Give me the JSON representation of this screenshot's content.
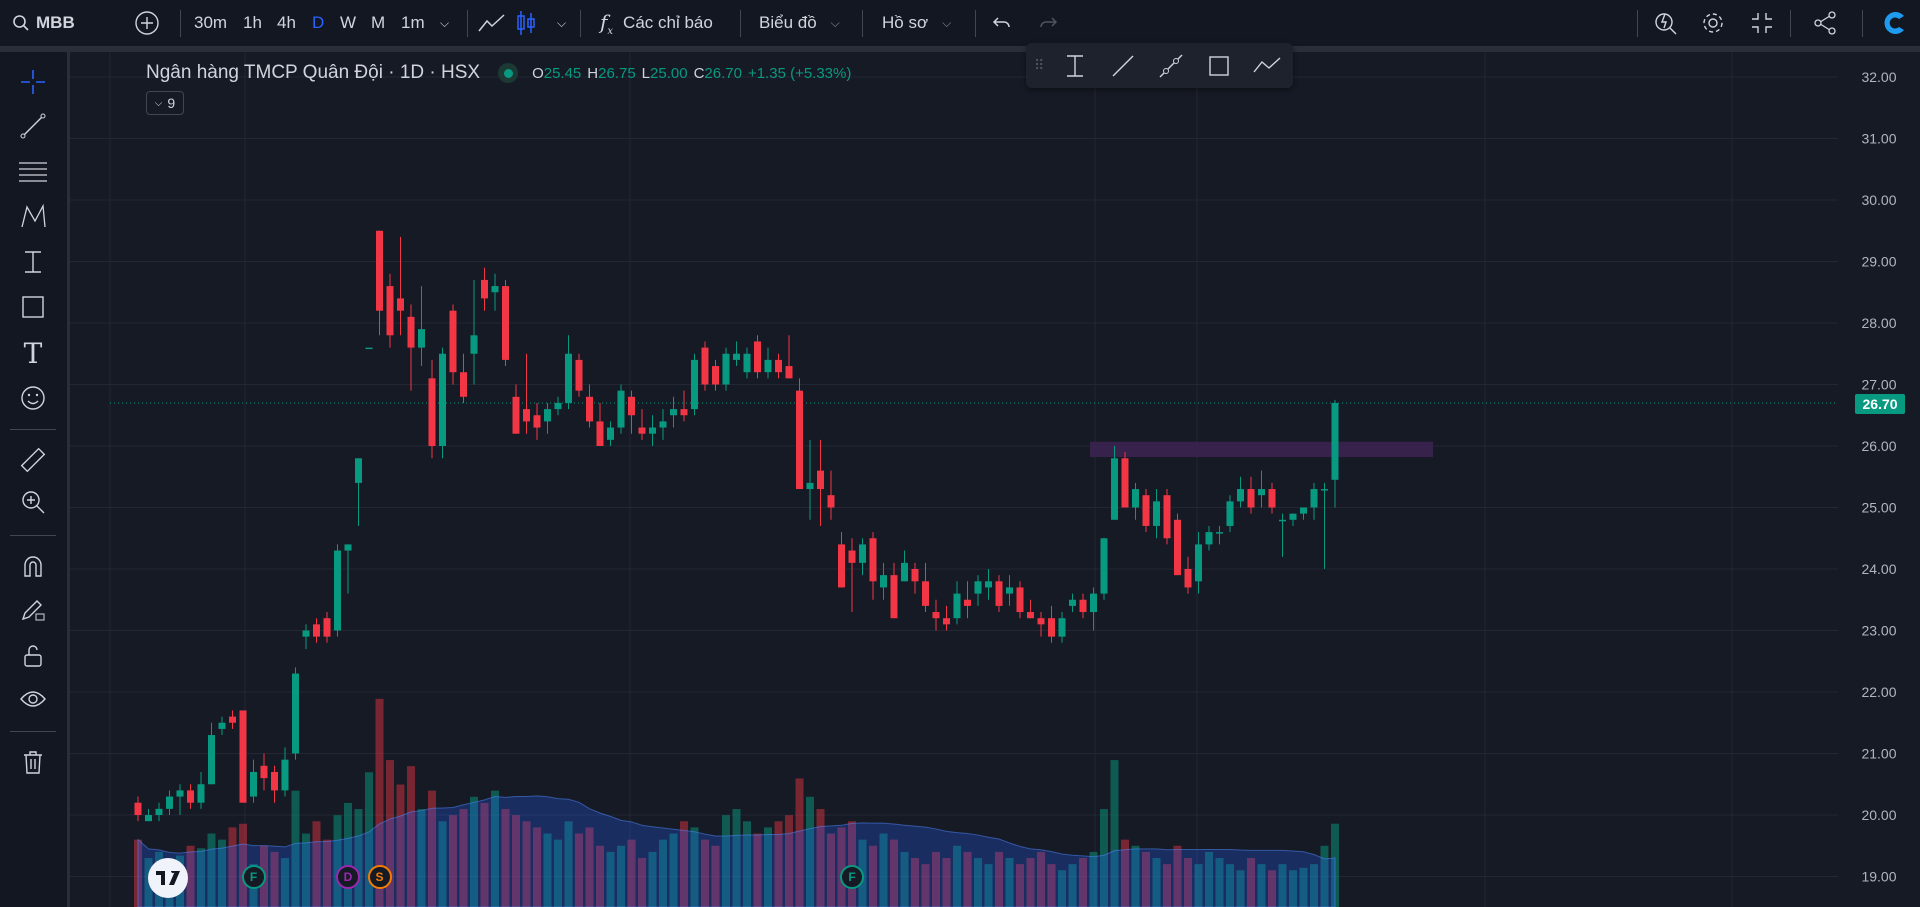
{
  "symbol": "MBB",
  "toolbar": {
    "intervals": [
      "30m",
      "1h",
      "4h",
      "D",
      "W",
      "M",
      "1m"
    ],
    "active_interval": "D",
    "indicators_label": "Các chỉ báo",
    "chart_label": "Biểu đồ",
    "profile_label": "Hồ sơ"
  },
  "legend": {
    "title": "Ngân hàng TMCP Quân Đội · 1D · HSX",
    "o_label": "O",
    "open": "25.45",
    "h_label": "H",
    "high": "26.75",
    "l_label": "L",
    "low": "25.00",
    "c_label": "C",
    "close": "26.70",
    "change": "+1.35 (+5.33%)",
    "collapsed_count": "9"
  },
  "last_price": "26.70",
  "colors": {
    "up": "#089981",
    "down": "#f23645",
    "accent": "#2962ff",
    "zone": "#3a2350"
  },
  "price_axis": [
    "32.00",
    "31.00",
    "30.00",
    "29.00",
    "28.00",
    "27.00",
    "26.00",
    "25.00",
    "24.00",
    "23.00",
    "22.00",
    "21.00",
    "20.00",
    "19.00"
  ],
  "chart_data": {
    "type": "candlestick",
    "ylim": [
      19,
      32
    ],
    "last": 26.7,
    "zone": [
      25.82,
      26.07
    ],
    "candles": [
      [
        20.2,
        20.3,
        19.9,
        20.0
      ],
      [
        19.9,
        20.1,
        19.9,
        20.0
      ],
      [
        20.0,
        20.2,
        19.9,
        20.1
      ],
      [
        20.1,
        20.4,
        20.0,
        20.3
      ],
      [
        20.3,
        20.5,
        20.0,
        20.4
      ],
      [
        20.4,
        20.5,
        20.1,
        20.2
      ],
      [
        20.2,
        20.7,
        20.1,
        20.5
      ],
      [
        20.5,
        21.5,
        20.5,
        21.3
      ],
      [
        21.4,
        21.6,
        21.3,
        21.5
      ],
      [
        21.6,
        21.7,
        21.4,
        21.5
      ],
      [
        21.7,
        21.7,
        20.2,
        20.2
      ],
      [
        20.3,
        20.9,
        20.2,
        20.7
      ],
      [
        20.8,
        21.0,
        20.4,
        20.6
      ],
      [
        20.7,
        20.8,
        20.2,
        20.4
      ],
      [
        20.4,
        21.1,
        20.3,
        20.9
      ],
      [
        21.0,
        22.4,
        20.9,
        22.3
      ],
      [
        22.9,
        23.1,
        22.7,
        23.0
      ],
      [
        23.1,
        23.2,
        22.8,
        22.9
      ],
      [
        23.2,
        23.3,
        22.8,
        22.9
      ],
      [
        23.0,
        24.4,
        22.9,
        24.3
      ],
      [
        24.3,
        24.4,
        23.6,
        24.4
      ],
      [
        25.4,
        25.8,
        24.7,
        25.8
      ],
      [
        27.6,
        27.6,
        27.6,
        27.6
      ],
      [
        29.5,
        29.5,
        27.8,
        28.2
      ],
      [
        28.6,
        28.8,
        27.6,
        27.8
      ],
      [
        28.4,
        29.4,
        27.8,
        28.2
      ],
      [
        28.1,
        28.3,
        26.9,
        27.6
      ],
      [
        27.6,
        28.6,
        27.3,
        27.9
      ],
      [
        27.1,
        27.4,
        25.8,
        26.0
      ],
      [
        26.0,
        27.6,
        25.8,
        27.5
      ],
      [
        28.2,
        28.3,
        27.0,
        27.2
      ],
      [
        27.2,
        27.5,
        26.7,
        26.8
      ],
      [
        27.5,
        28.7,
        27.0,
        27.8
      ],
      [
        28.7,
        28.9,
        28.2,
        28.4
      ],
      [
        28.5,
        28.8,
        28.2,
        28.6
      ],
      [
        28.6,
        28.7,
        27.3,
        27.4
      ],
      [
        26.8,
        27.0,
        26.2,
        26.2
      ],
      [
        26.6,
        27.5,
        26.2,
        26.4
      ],
      [
        26.5,
        26.7,
        26.1,
        26.3
      ],
      [
        26.4,
        26.7,
        26.2,
        26.6
      ],
      [
        26.6,
        26.8,
        26.5,
        26.7
      ],
      [
        26.7,
        27.8,
        26.6,
        27.5
      ],
      [
        27.4,
        27.5,
        26.8,
        26.9
      ],
      [
        26.8,
        27.0,
        26.3,
        26.4
      ],
      [
        26.4,
        26.7,
        26.0,
        26.0
      ],
      [
        26.1,
        26.4,
        26.0,
        26.3
      ],
      [
        26.3,
        27.0,
        26.2,
        26.9
      ],
      [
        26.8,
        26.9,
        26.2,
        26.5
      ],
      [
        26.3,
        26.6,
        26.1,
        26.2
      ],
      [
        26.2,
        26.5,
        26.0,
        26.3
      ],
      [
        26.3,
        26.6,
        26.1,
        26.4
      ],
      [
        26.5,
        26.8,
        26.3,
        26.6
      ],
      [
        26.6,
        26.9,
        26.4,
        26.5
      ],
      [
        26.6,
        27.5,
        26.5,
        27.4
      ],
      [
        27.6,
        27.7,
        26.9,
        27.0
      ],
      [
        27.3,
        27.4,
        26.9,
        27.0
      ],
      [
        27.0,
        27.6,
        26.9,
        27.5
      ],
      [
        27.4,
        27.7,
        27.3,
        27.5
      ],
      [
        27.2,
        27.6,
        27.1,
        27.5
      ],
      [
        27.7,
        27.8,
        27.1,
        27.2
      ],
      [
        27.2,
        27.6,
        27.1,
        27.4
      ],
      [
        27.4,
        27.5,
        27.1,
        27.2
      ],
      [
        27.3,
        27.8,
        27.1,
        27.1
      ],
      [
        26.9,
        27.1,
        25.3,
        25.3
      ],
      [
        25.3,
        26.1,
        24.8,
        25.4
      ],
      [
        25.6,
        26.1,
        24.7,
        25.3
      ],
      [
        25.2,
        25.6,
        24.8,
        25.0
      ],
      [
        24.4,
        24.6,
        23.7,
        23.7
      ],
      [
        24.3,
        24.5,
        23.3,
        24.1
      ],
      [
        24.1,
        24.5,
        23.9,
        24.4
      ],
      [
        24.5,
        24.6,
        23.5,
        23.8
      ],
      [
        23.7,
        24.1,
        23.5,
        23.9
      ],
      [
        23.9,
        24.1,
        23.2,
        23.2
      ],
      [
        23.8,
        24.3,
        23.8,
        24.1
      ],
      [
        24.0,
        24.1,
        23.6,
        23.8
      ],
      [
        23.8,
        24.1,
        23.3,
        23.4
      ],
      [
        23.3,
        23.5,
        23.0,
        23.2
      ],
      [
        23.2,
        23.4,
        23.0,
        23.1
      ],
      [
        23.2,
        23.8,
        23.1,
        23.6
      ],
      [
        23.5,
        23.8,
        23.2,
        23.4
      ],
      [
        23.6,
        23.9,
        23.4,
        23.8
      ],
      [
        23.7,
        24.0,
        23.5,
        23.8
      ],
      [
        23.8,
        23.9,
        23.3,
        23.4
      ],
      [
        23.6,
        23.9,
        23.4,
        23.7
      ],
      [
        23.7,
        23.8,
        23.2,
        23.3
      ],
      [
        23.3,
        23.5,
        23.2,
        23.2
      ],
      [
        23.2,
        23.3,
        22.9,
        23.1
      ],
      [
        23.2,
        23.4,
        22.8,
        22.9
      ],
      [
        22.9,
        23.3,
        22.8,
        23.2
      ],
      [
        23.4,
        23.6,
        23.3,
        23.5
      ],
      [
        23.5,
        23.6,
        23.2,
        23.3
      ],
      [
        23.3,
        23.7,
        23.0,
        23.6
      ],
      [
        23.6,
        24.5,
        23.5,
        24.5
      ],
      [
        24.8,
        26.0,
        24.8,
        25.8
      ],
      [
        25.8,
        25.9,
        25.0,
        25.0
      ],
      [
        25.0,
        25.4,
        24.8,
        25.3
      ],
      [
        25.2,
        25.3,
        24.6,
        24.7
      ],
      [
        24.7,
        25.3,
        24.5,
        25.1
      ],
      [
        25.2,
        25.3,
        24.4,
        24.5
      ],
      [
        24.8,
        24.9,
        23.9,
        23.9
      ],
      [
        24.0,
        24.2,
        23.6,
        23.7
      ],
      [
        23.8,
        24.6,
        23.6,
        24.4
      ],
      [
        24.4,
        24.7,
        24.3,
        24.6
      ],
      [
        24.6,
        24.7,
        24.4,
        24.6
      ],
      [
        24.7,
        25.2,
        24.6,
        25.1
      ],
      [
        25.1,
        25.5,
        25.0,
        25.3
      ],
      [
        25.3,
        25.5,
        24.9,
        25.0
      ],
      [
        25.2,
        25.6,
        25.0,
        25.3
      ],
      [
        25.3,
        25.4,
        24.9,
        25.0
      ],
      [
        24.8,
        24.9,
        24.2,
        24.8
      ],
      [
        24.8,
        24.9,
        24.7,
        24.9
      ],
      [
        24.9,
        25.0,
        24.8,
        25.0
      ],
      [
        25.0,
        25.4,
        24.8,
        25.3
      ],
      [
        25.3,
        25.4,
        24.0,
        25.3
      ],
      [
        25.45,
        26.75,
        25.0,
        26.7
      ]
    ],
    "volume": [
      55,
      40,
      45,
      38,
      42,
      50,
      48,
      60,
      55,
      65,
      68,
      35,
      50,
      45,
      40,
      95,
      60,
      70,
      55,
      75,
      85,
      80,
      110,
      170,
      120,
      100,
      115,
      80,
      95,
      70,
      75,
      80,
      90,
      85,
      95,
      80,
      75,
      70,
      65,
      60,
      55,
      70,
      60,
      65,
      50,
      45,
      50,
      55,
      40,
      45,
      55,
      60,
      70,
      65,
      55,
      50,
      75,
      80,
      70,
      60,
      65,
      70,
      75,
      105,
      90,
      80,
      60,
      65,
      70,
      55,
      50,
      60,
      55,
      45,
      40,
      35,
      45,
      40,
      50,
      45,
      40,
      35,
      45,
      40,
      35,
      40,
      45,
      35,
      30,
      35,
      40,
      45,
      80,
      120,
      55,
      50,
      45,
      40,
      35,
      50,
      40,
      35,
      45,
      40,
      35,
      30,
      40,
      35,
      30,
      35,
      30,
      32,
      35,
      50,
      68
    ],
    "events": [
      {
        "label": "F",
        "index": 11,
        "color": "#089981"
      },
      {
        "label": "D",
        "index": 20,
        "color": "#9c27b0"
      },
      {
        "label": "S",
        "index": 23,
        "color": "#f57c00"
      },
      {
        "label": "F",
        "index": 68,
        "color": "#089981"
      }
    ]
  }
}
